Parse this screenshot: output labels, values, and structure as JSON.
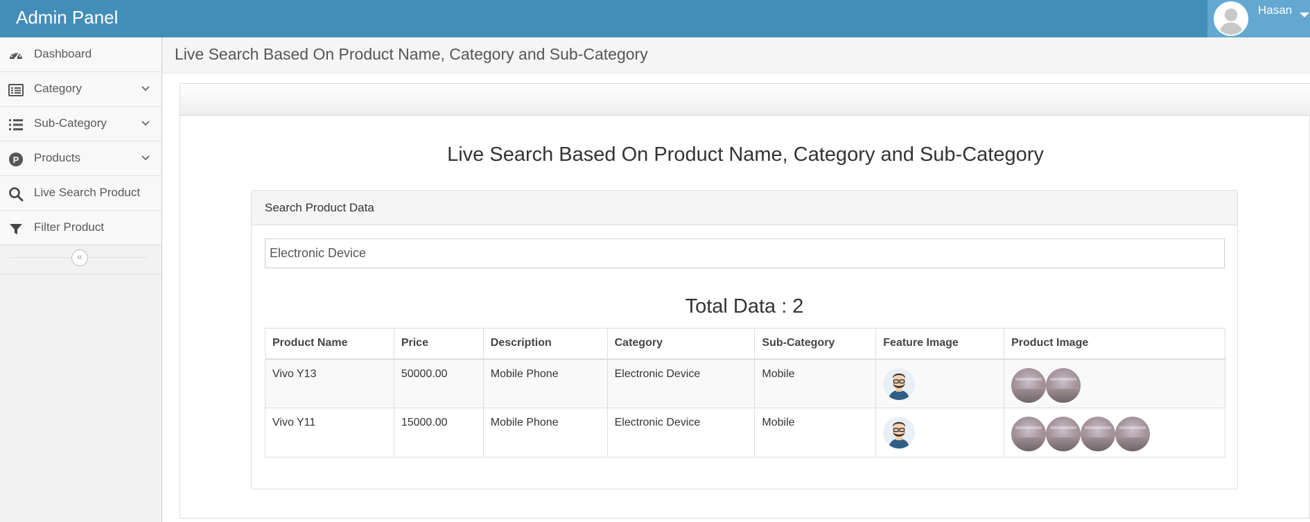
{
  "header": {
    "brand": "Admin Panel",
    "user_name": "Hasan"
  },
  "sidebar": {
    "items": [
      {
        "label": "Dashboard",
        "icon": "dashboard-icon"
      },
      {
        "label": "Category",
        "icon": "list-alt-icon"
      },
      {
        "label": "Sub-Category",
        "icon": "list-icon"
      },
      {
        "label": "Products",
        "icon": "product-p-icon"
      },
      {
        "label": "Live Search Product",
        "icon": "search-icon"
      },
      {
        "label": "Filter Product",
        "icon": "filter-icon"
      }
    ],
    "collapse_icon": "double-chevron-left-icon"
  },
  "page_header": {
    "title": "Live Search Based On Product Name, Category and Sub-Category"
  },
  "main": {
    "title": "Live Search Based On Product Name, Category and Sub-Category",
    "panel_heading": "Search Product Data",
    "search": {
      "value": "Electronic Device",
      "placeholder": "Electronic Device"
    },
    "total_label": "Total Data : 2",
    "table": {
      "columns": [
        "Product Name",
        "Price",
        "Description",
        "Category",
        "Sub-Category",
        "Feature Image",
        "Product Image"
      ],
      "rows": [
        {
          "name": "Vivo Y13",
          "price": "50000.00",
          "description": "Mobile Phone",
          "category": "Electronic Device",
          "sub_category": "Mobile",
          "feature_image": "avatar-man-icon",
          "product_image_count": 2
        },
        {
          "name": "Vivo Y11",
          "price": "15000.00",
          "description": "Mobile Phone",
          "category": "Electronic Device",
          "sub_category": "Mobile",
          "feature_image": "avatar-man-icon",
          "product_image_count": 4
        }
      ]
    }
  },
  "colors": {
    "topbar": "#438eb9",
    "user_area": "#62a8d1",
    "sidebar_bg": "#f2f2f2"
  }
}
